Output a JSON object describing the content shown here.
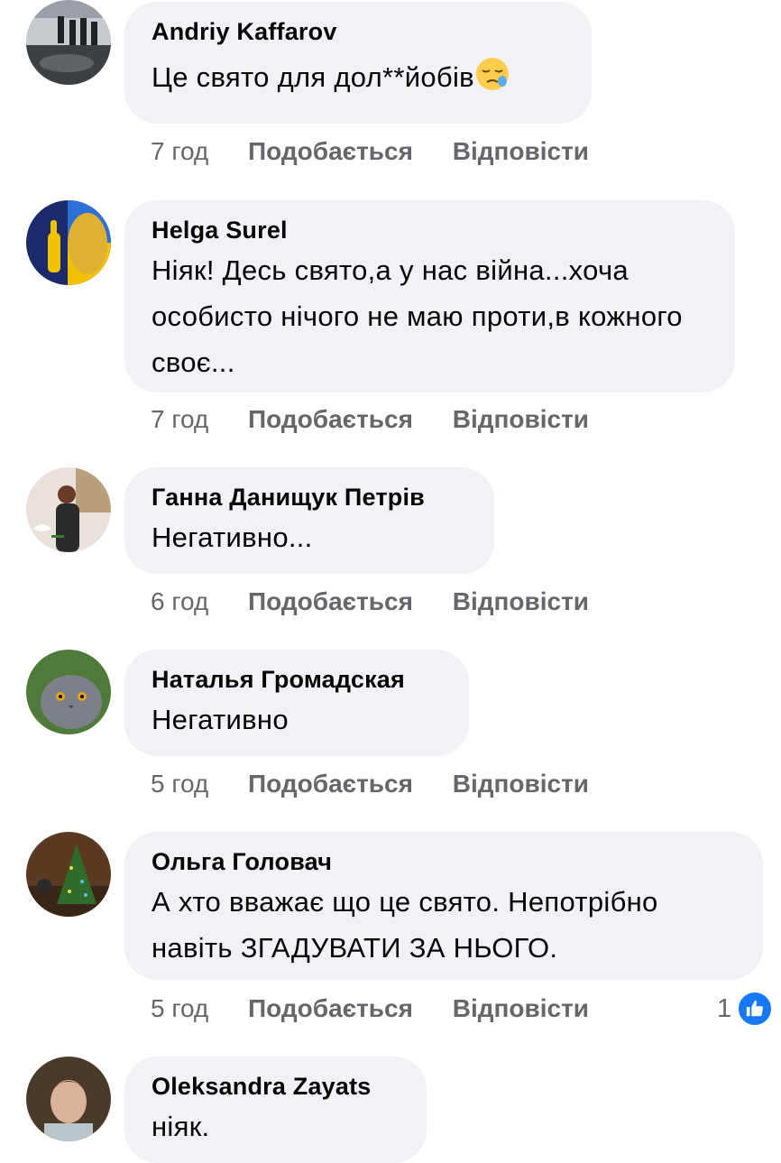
{
  "comments": [
    {
      "author": "Andriy Kaffarov",
      "text": "Це свято для дол**йобів",
      "emoji": "sleepy-face",
      "time": "7 год",
      "like_label": "Подобається",
      "reply_label": "Відповісти"
    },
    {
      "author": "Helga Surel",
      "text": "Ніяк!  Десь свято,а у нас війна...хоча особисто нічого не маю проти,в кожного своє...",
      "time": "7 год",
      "like_label": "Подобається",
      "reply_label": "Відповісти"
    },
    {
      "author": "Ганна Данищук Петрів",
      "text": "Негативно...",
      "time": "6 год",
      "like_label": "Подобається",
      "reply_label": "Відповісти"
    },
    {
      "author": "Наталья Громадская",
      "text": "Негативно",
      "time": "5 год",
      "like_label": "Подобається",
      "reply_label": "Відповісти"
    },
    {
      "author": "Ольга Головач",
      "text": "А хто вважає що це свято. Непотрібно навіть ЗГАДУВАТИ  ЗА НЬОГО.",
      "time": "5 год",
      "like_label": "Подобається",
      "reply_label": "Відповісти",
      "reaction_count": "1",
      "reaction_icon": "thumbs-up-icon"
    },
    {
      "author": "Oleksandra Zayats",
      "text": "ніяк."
    }
  ],
  "colors": {
    "bubble": "#f0f2f5",
    "meta_text": "#65676b",
    "like_blue": "#1877f2"
  }
}
